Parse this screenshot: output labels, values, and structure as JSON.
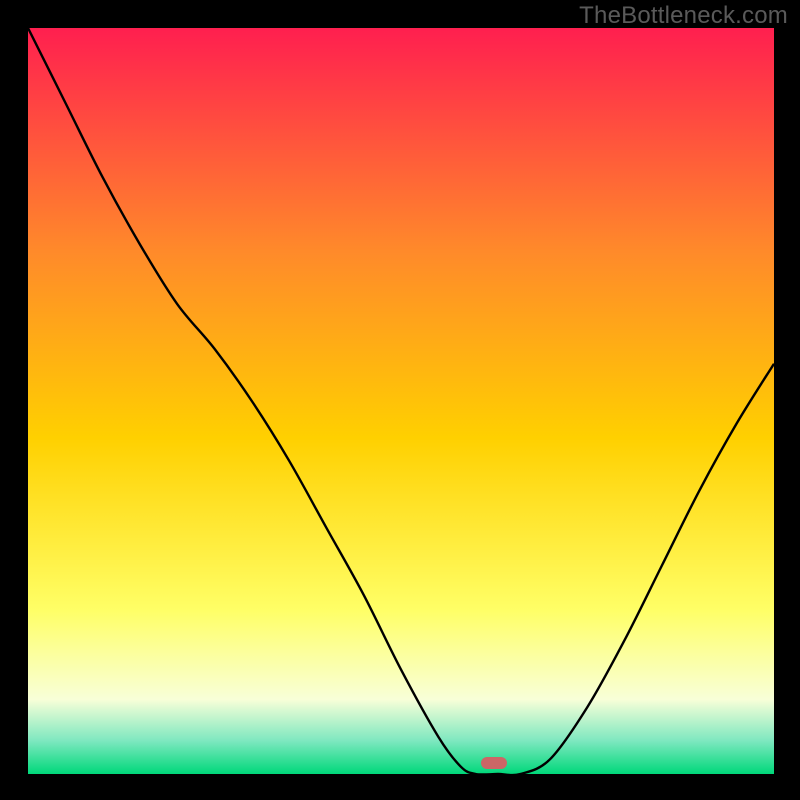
{
  "watermark": "TheBottleneck.com",
  "marker": {
    "x_frac": 0.625,
    "y_frac": 0.985
  },
  "colors": {
    "gradient_top": "#ff1f4f",
    "gradient_upper": "#ff8a2a",
    "gradient_mid": "#ffd000",
    "gradient_lower": "#ffff66",
    "gradient_pale": "#f8ffd8",
    "gradient_teal": "#7fe8c0",
    "gradient_green": "#00d87a",
    "curve": "#000000",
    "background": "#000000",
    "marker": "#cc6666"
  },
  "chart_data": {
    "type": "line",
    "title": "",
    "xlabel": "",
    "ylabel": "",
    "xlim": [
      0,
      1
    ],
    "ylim": [
      0,
      1
    ],
    "x": [
      0.0,
      0.05,
      0.1,
      0.15,
      0.2,
      0.25,
      0.3,
      0.35,
      0.4,
      0.45,
      0.5,
      0.55,
      0.58,
      0.6,
      0.63,
      0.66,
      0.7,
      0.75,
      0.8,
      0.85,
      0.9,
      0.95,
      1.0
    ],
    "series": [
      {
        "name": "bottleneck-curve",
        "values": [
          1.0,
          0.9,
          0.8,
          0.71,
          0.63,
          0.57,
          0.5,
          0.42,
          0.33,
          0.24,
          0.14,
          0.05,
          0.01,
          0.0,
          0.0,
          0.0,
          0.02,
          0.09,
          0.18,
          0.28,
          0.38,
          0.47,
          0.55
        ]
      }
    ],
    "annotations": [
      {
        "type": "marker",
        "shape": "rounded-rect",
        "x": 0.625,
        "y": 0.0,
        "color": "#cc6666"
      }
    ],
    "background_gradient": {
      "direction": "vertical",
      "stops": [
        {
          "pos": 0.0,
          "color": "#ff1f4f"
        },
        {
          "pos": 0.3,
          "color": "#ff8a2a"
        },
        {
          "pos": 0.55,
          "color": "#ffd000"
        },
        {
          "pos": 0.78,
          "color": "#ffff66"
        },
        {
          "pos": 0.9,
          "color": "#f8ffd8"
        },
        {
          "pos": 0.955,
          "color": "#7fe8c0"
        },
        {
          "pos": 1.0,
          "color": "#00d87a"
        }
      ]
    }
  }
}
